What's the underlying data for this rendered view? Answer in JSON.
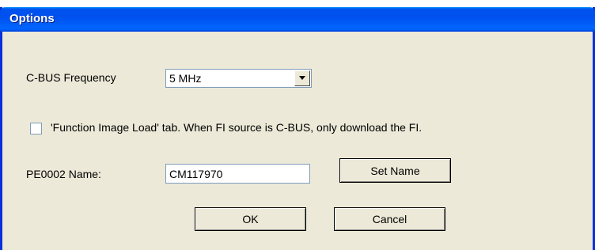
{
  "window": {
    "title": "Options"
  },
  "frequency": {
    "label": "C-BUS Frequency",
    "selected_value": "5 MHz",
    "dropdown_icon": "chevron-down-icon"
  },
  "fi_option": {
    "checked": false,
    "label": "'Function Image Load' tab. When FI source is C-BUS, only download the FI."
  },
  "name_row": {
    "label": "PE0002 Name:",
    "value": "CM117970",
    "set_button": "Set Name"
  },
  "footer": {
    "ok_label": "OK",
    "cancel_label": "Cancel"
  }
}
